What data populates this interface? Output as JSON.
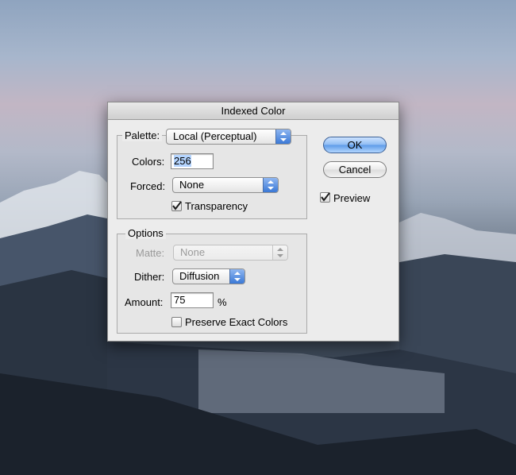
{
  "dialog": {
    "title": "Indexed Color",
    "palette": {
      "label": "Palette:",
      "value": "Local (Perceptual)"
    },
    "colors": {
      "label": "Colors:",
      "value": "256"
    },
    "forced": {
      "label": "Forced:",
      "value": "None"
    },
    "transparency": {
      "label": "Transparency",
      "checked": true
    },
    "options": {
      "legend": "Options",
      "matte": {
        "label": "Matte:",
        "value": "None",
        "enabled": false
      },
      "dither": {
        "label": "Dither:",
        "value": "Diffusion"
      },
      "amount": {
        "label": "Amount:",
        "value": "75",
        "unit": "%"
      },
      "preserve_exact_colors": {
        "label": "Preserve Exact Colors",
        "checked": false
      }
    },
    "buttons": {
      "ok": "OK",
      "cancel": "Cancel"
    },
    "preview": {
      "label": "Preview",
      "checked": true
    }
  }
}
